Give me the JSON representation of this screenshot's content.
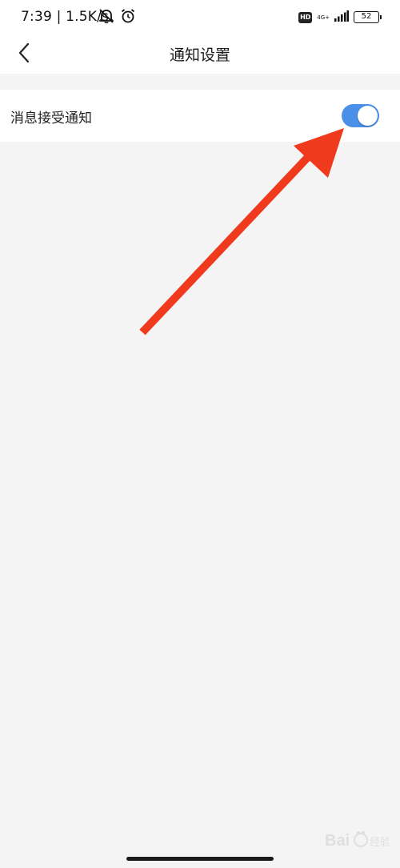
{
  "status_bar": {
    "time": "7:39 | 1.5K/s",
    "hd": "HD",
    "network": "4G+",
    "battery": "52"
  },
  "header": {
    "title": "通知设置"
  },
  "settings": {
    "message_notification": {
      "label": "消息接受通知",
      "enabled": true
    }
  },
  "colors": {
    "toggle_on": "#4a90e8",
    "arrow": "#f03a1e",
    "background": "#f4f4f5"
  },
  "icons": {
    "back": "chevron-left-icon",
    "mute": "bell-off-icon",
    "alarm": "alarm-clock-icon",
    "signal": "signal-icon",
    "battery": "battery-icon"
  },
  "watermark": {
    "text": "Bai 经验"
  }
}
